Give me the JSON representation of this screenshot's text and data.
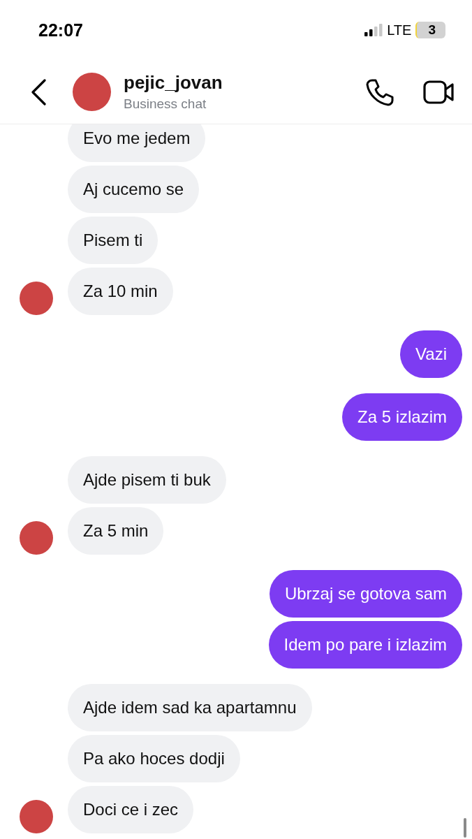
{
  "status_bar": {
    "time": "22:07",
    "network": "LTE",
    "battery": "3"
  },
  "header": {
    "name": "pejic_jovan",
    "subtitle": "Business chat"
  },
  "groups": [
    {
      "kind": "incoming",
      "messages": [
        "Evo me jedem",
        "Aj cucemo se",
        "Pisem ti",
        "Za 10 min"
      ]
    },
    {
      "kind": "outgoing",
      "messages": [
        "Vazi"
      ]
    },
    {
      "kind": "outgoing",
      "messages": [
        "Za 5 izlazim"
      ]
    },
    {
      "kind": "incoming",
      "messages": [
        "Ajde pisem ti buk",
        "Za 5 min"
      ]
    },
    {
      "kind": "outgoing",
      "messages": [
        "Ubrzaj se gotova sam",
        "Idem po pare i izlazim"
      ]
    },
    {
      "kind": "incoming",
      "messages": [
        "Ajde idem sad ka apartamnu",
        "Pa ako hoces dodji",
        "Doci ce i zec"
      ]
    }
  ]
}
